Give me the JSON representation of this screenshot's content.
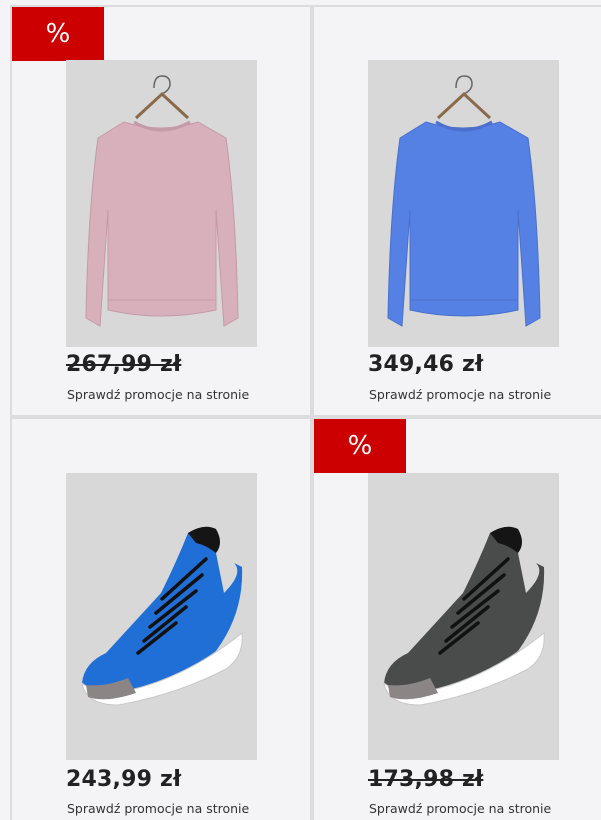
{
  "products": [
    {
      "badge": "%",
      "price": "267,99 zł",
      "price_struck": true,
      "promo_text": "Sprawdź promocje na stronie",
      "image_icon": "sweatshirt-icon",
      "color": "#d8b0bb"
    },
    {
      "badge": "",
      "price": "349,46 zł",
      "price_struck": false,
      "promo_text": "Sprawdź promocje na stronie",
      "image_icon": "sweatshirt-icon",
      "color": "#5580e4"
    },
    {
      "badge": "",
      "price": "243,99 zł",
      "price_struck": false,
      "promo_text": "Sprawdź promocje na stronie",
      "image_icon": "sneaker-icon",
      "color": "#1f6fd6"
    },
    {
      "badge": "%",
      "price": "173,98 zł",
      "price_struck": true,
      "promo_text": "Sprawdź promocje na stronie",
      "image_icon": "sneaker-icon",
      "color": "#4a4c4b"
    }
  ],
  "colors": {
    "badge_bg": "#cc0000",
    "card_border": "#dcdcde",
    "photo_bg": "#d8d8d8"
  }
}
